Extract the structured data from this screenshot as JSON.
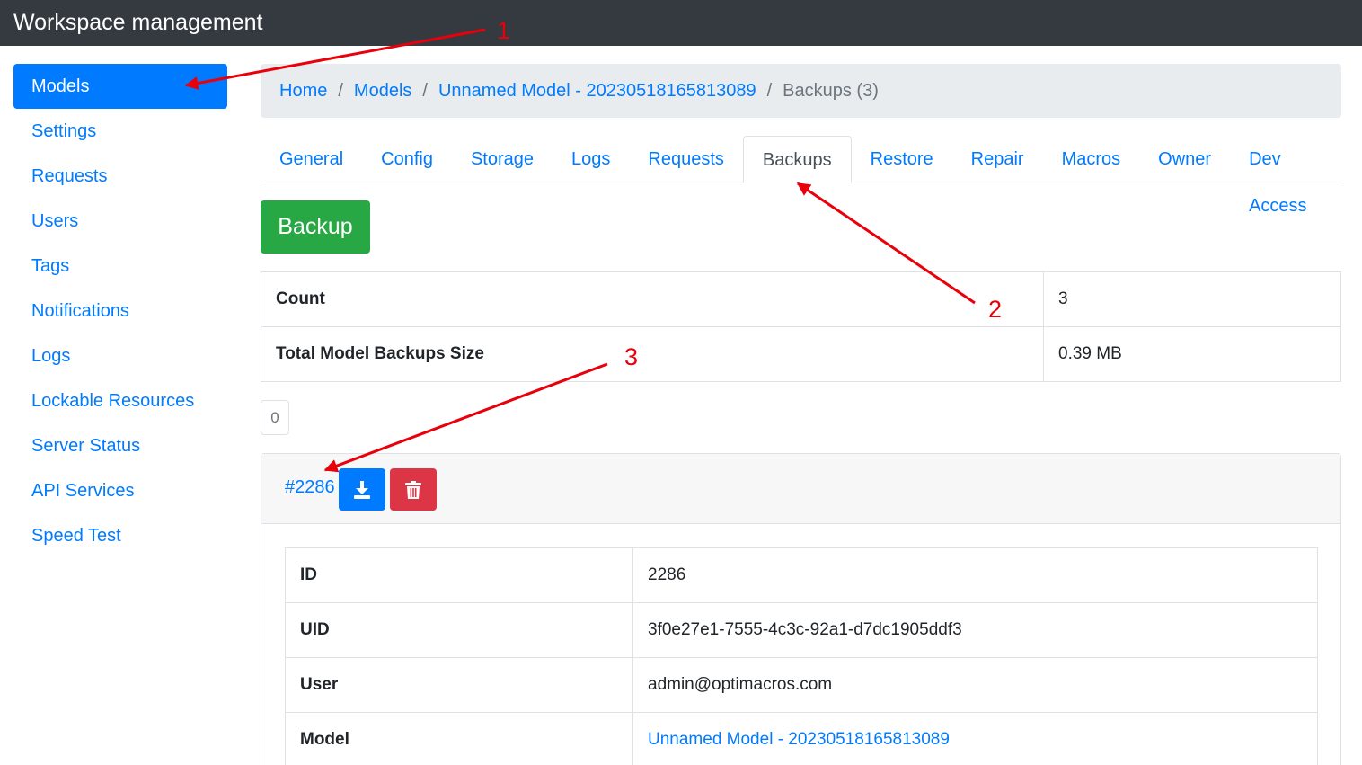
{
  "app": {
    "title": "Workspace management"
  },
  "sidebar": {
    "items": [
      {
        "label": "Models",
        "active": true
      },
      {
        "label": "Settings"
      },
      {
        "label": "Requests"
      },
      {
        "label": "Users"
      },
      {
        "label": "Tags"
      },
      {
        "label": "Notifications"
      },
      {
        "label": "Logs"
      },
      {
        "label": "Lockable Resources"
      },
      {
        "label": "Server Status"
      },
      {
        "label": "API Services"
      },
      {
        "label": "Speed Test"
      }
    ]
  },
  "breadcrumb": {
    "items": [
      "Home",
      "Models",
      "Unnamed Model - 20230518165813089",
      "Backups (3)"
    ],
    "separator": "/"
  },
  "tabs": [
    "General",
    "Config",
    "Storage",
    "Logs",
    "Requests",
    "Backups",
    "Restore",
    "Repair",
    "Macros",
    "Owner",
    "Dev Access"
  ],
  "active_tab": "Backups",
  "backup_button": "Backup",
  "summary": [
    {
      "label": "Count",
      "value": "3"
    },
    {
      "label": "Total Model Backups Size",
      "value": "0.39 MB"
    }
  ],
  "pager": {
    "value": "0"
  },
  "backup": {
    "link": "#2286",
    "download_icon": "download-icon",
    "delete_icon": "trash-icon",
    "details": [
      {
        "label": "ID",
        "value": "2286"
      },
      {
        "label": "UID",
        "value": "3f0e27e1-7555-4c3c-92a1-d7dc1905ddf3"
      },
      {
        "label": "User",
        "value": "admin@optimacros.com"
      },
      {
        "label": "Model",
        "value": "Unnamed Model - 20230518165813089"
      }
    ]
  },
  "annotations": [
    "1",
    "2",
    "3"
  ],
  "colors": {
    "primary": "#007bff",
    "success": "#28a745",
    "danger": "#dc3545",
    "topbar": "#343a40",
    "annotation": "#e8000b"
  }
}
